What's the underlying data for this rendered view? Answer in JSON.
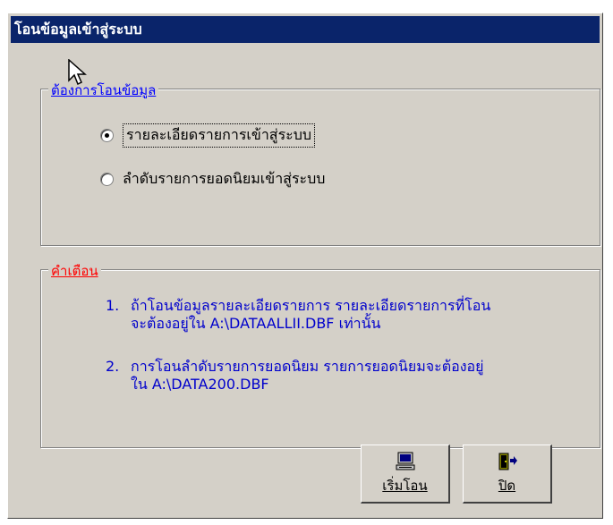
{
  "window": {
    "title": "โอนข้อมูลเข้าสู่ระบบ"
  },
  "transfer_group": {
    "label": "ต้องการโอนข้อมูล",
    "options": [
      {
        "label": "รายละเอียดรายการเข้าสู่ระบบ",
        "selected": true
      },
      {
        "label": "ลำดับรายการยอดนิยมเข้าสู่ระบบ",
        "selected": false
      }
    ]
  },
  "warning_group": {
    "label": "คำเตือน",
    "notes": [
      {
        "num": "1.",
        "line1": "ถ้าโอนข้อมูลรายละเอียดรายการ  รายละเอียดรายการที่โอน",
        "line2": "จะต้องอยู่ใน  A:\\DATAALLII.DBF เท่านั้น"
      },
      {
        "num": "2.",
        "line1": "การโอนลำดับรายการยอดนิยม  รายการยอดนิยมจะต้องอยู่",
        "line2": "ใน A:\\DATA200.DBF"
      }
    ]
  },
  "buttons": {
    "start_label": "เริ่มโอน",
    "close_label": "ปิด",
    "start_icon": "computer-icon",
    "close_icon": "exit-door-icon"
  },
  "colors": {
    "title_bar": "#0a246a",
    "dialog_bg": "#d4d0c8",
    "group1_label": "#0000ff",
    "group2_label": "#ff0000",
    "note_text": "#0000cc"
  }
}
